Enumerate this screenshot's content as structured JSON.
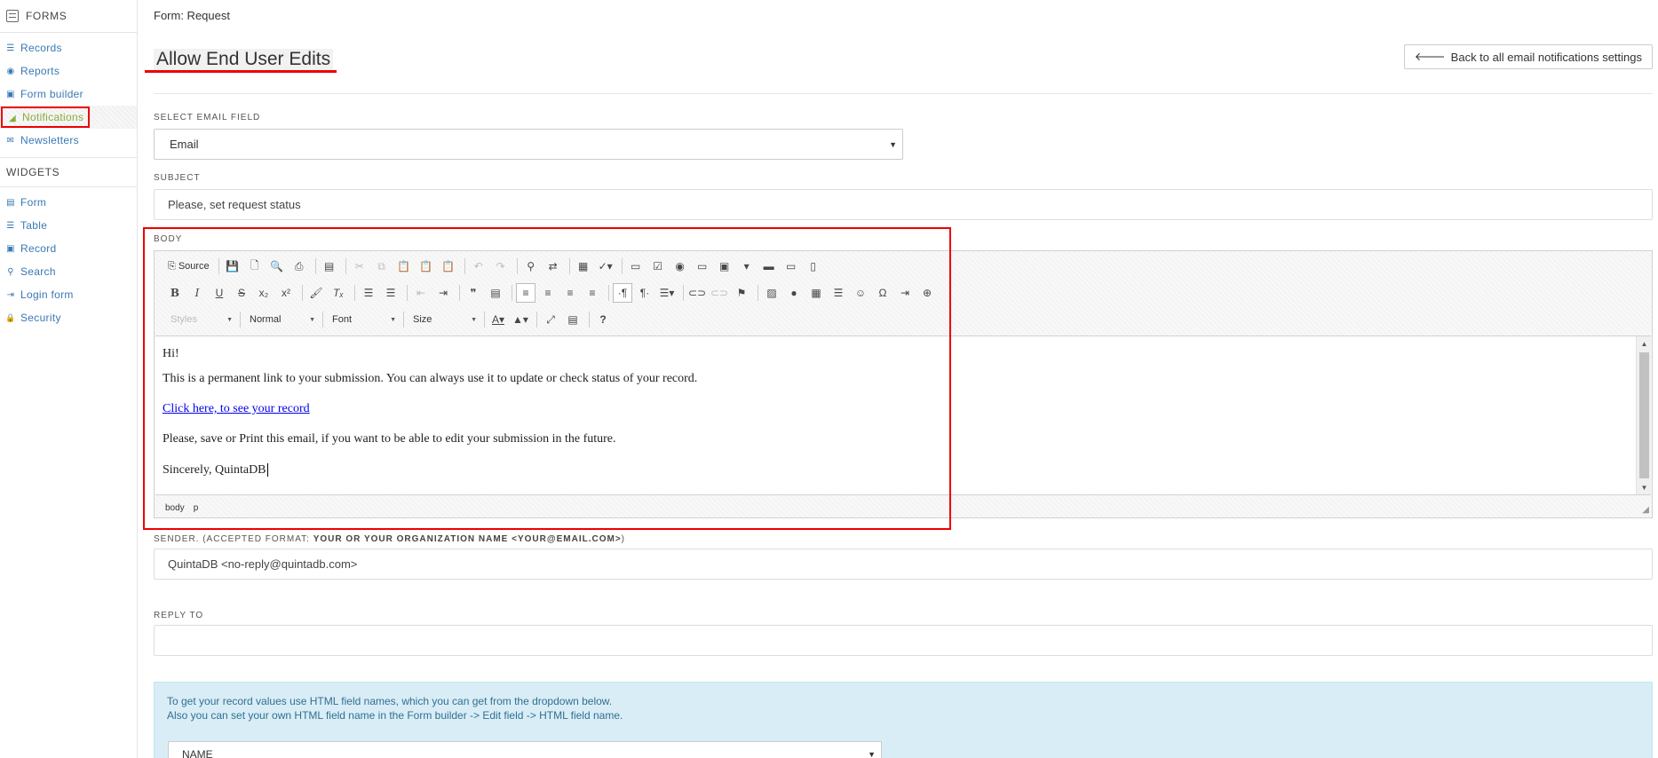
{
  "sidebar": {
    "forms_label": "FORMS",
    "items": [
      {
        "label": "Records",
        "icon": "list-icon",
        "glyph": "☰"
      },
      {
        "label": "Reports",
        "icon": "reports-icon",
        "glyph": "◉"
      },
      {
        "label": "Form builder",
        "icon": "form-builder-icon",
        "glyph": "▣"
      },
      {
        "label": "Notifications",
        "icon": "megaphone-icon",
        "glyph": "◢"
      },
      {
        "label": "Newsletters",
        "icon": "envelope-icon",
        "glyph": "✉"
      }
    ],
    "widgets_label": "WIDGETS",
    "widgets": [
      {
        "label": "Form",
        "icon": "form-icon",
        "glyph": "▤"
      },
      {
        "label": "Table",
        "icon": "table-icon",
        "glyph": "☰"
      },
      {
        "label": "Record",
        "icon": "record-icon",
        "glyph": "▣"
      },
      {
        "label": "Search",
        "icon": "search-icon",
        "glyph": "⚲"
      },
      {
        "label": "Login form",
        "icon": "login-icon",
        "glyph": "⇥"
      },
      {
        "label": "Security",
        "icon": "lock-icon",
        "glyph": "🔒"
      }
    ]
  },
  "header": {
    "breadcrumb": "Form: Request",
    "title": "Allow End User Edits",
    "back_button": "Back to all email notifications settings"
  },
  "form": {
    "email_field_label": "SELECT EMAIL FIELD",
    "email_field_value": "Email",
    "subject_label": "SUBJECT",
    "subject_value": "Please, set request status",
    "body_label": "BODY",
    "sender_label_prefix": "SENDER. (ACCEPTED FORMAT: ",
    "sender_label_format": "YOUR OR YOUR ORGANIZATION NAME <YOUR@EMAIL.COM>",
    "sender_label_suffix": ")",
    "sender_value": "QuintaDB <no-reply@quintadb.com>",
    "reply_to_label": "REPLY TO",
    "reply_to_value": ""
  },
  "editor": {
    "source_label": "Source",
    "styles_combo": "Styles",
    "format_combo": "Normal",
    "font_combo": "Font",
    "size_combo": "Size",
    "body_lines": {
      "greeting": "Hi!",
      "line1": "This is a permanent link to your submission. You can always use it to update or check status of your record.",
      "link": "Click here, to see your record",
      "line2": "Please, save or Print this email, if you want to be able to edit your submission in the future.",
      "signature": "Sincerely, QuintaDB"
    },
    "path": [
      "body",
      "p"
    ]
  },
  "info": {
    "line1": "To get your record values use HTML field names, which you can get from the dropdown below.",
    "line2": "Also you can set your own HTML field name in the Form builder -> Edit field -> HTML field name.",
    "select_value": "NAME"
  },
  "colors": {
    "link": "#3a78b5",
    "active_item": "#8aac3a",
    "highlight": "#ee0000",
    "info_bg": "#d9edf7"
  }
}
